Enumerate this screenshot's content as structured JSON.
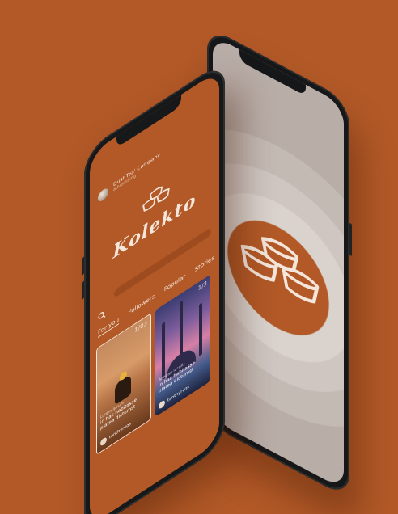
{
  "colors": {
    "background": "#b25927",
    "accent": "#b25927",
    "text_light": "#f4e6db",
    "phone_frame": "#17181a"
  },
  "splash": {
    "logo_icon": "dumpling-logo-icon"
  },
  "app": {
    "header": {
      "company_name": "Dust Tea' Company",
      "company_sub": "advertising"
    },
    "logo_icon": "dumpling-logo-icon",
    "brand_name": "Kolekto",
    "search_icon": "search-icon",
    "tabs": [
      {
        "label": "For you"
      },
      {
        "label": "Followers"
      },
      {
        "label": "Popular"
      },
      {
        "label": "Stories"
      }
    ],
    "cards": [
      {
        "count": "1/03",
        "text_small": "Lorem ipsum",
        "text": "in hac habitasse platea dictumst",
        "username": "tanthyrvos"
      },
      {
        "count": "1/3",
        "text_small": "Aenean iaculis",
        "text": "in hac habitasse platea dictumst",
        "username": "tanthyrvos"
      }
    ]
  }
}
